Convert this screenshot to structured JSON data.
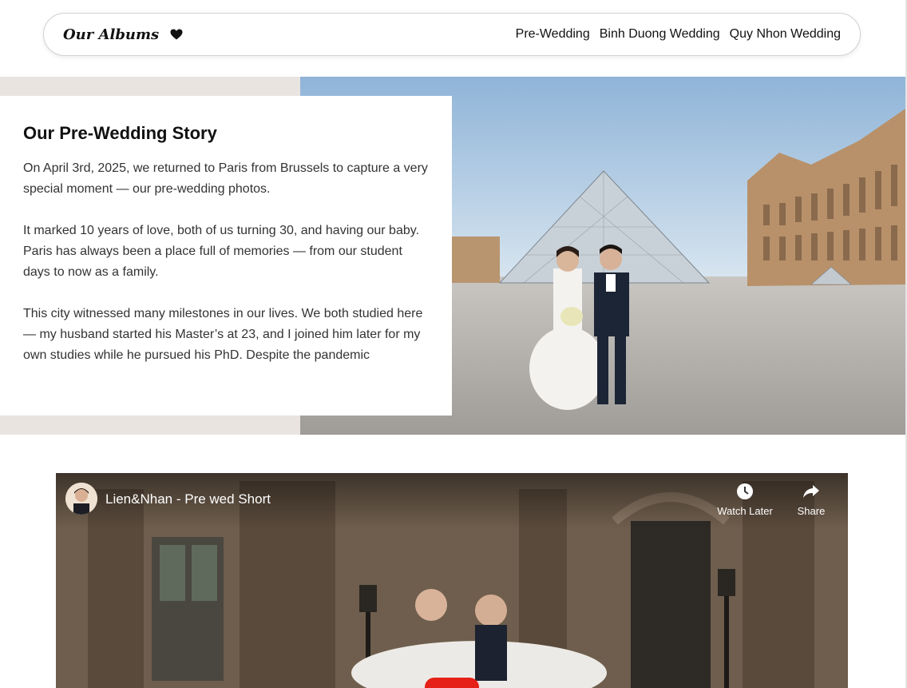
{
  "navbar": {
    "brand_title": "Our Albums",
    "brand_icon": "heart-icon",
    "links": [
      "Pre-Wedding",
      "Binh Duong Wedding",
      "Quy Nhon Wedding"
    ]
  },
  "story": {
    "title": "Our Pre-Wedding Story",
    "paragraphs": [
      "On April 3rd, 2025, we returned to Paris from Brussels to capture a very special moment — our pre-wedding photos.",
      "It marked 10 years of love, both of us turning 30, and having our baby. Paris has always been a place full of memories — from our student days to now as a family.",
      "This city witnessed many milestones in our lives. We both studied here — my husband started his Master’s at 23, and I joined him later for my own studies while he pursued his PhD. Despite the pandemic"
    ]
  },
  "video": {
    "title": "Lien&Nhan - Pre wed Short",
    "watch_later": "Watch Later",
    "share": "Share"
  },
  "colors": {
    "hero_background": "#e9e4e0",
    "play_button": "#e62117"
  }
}
